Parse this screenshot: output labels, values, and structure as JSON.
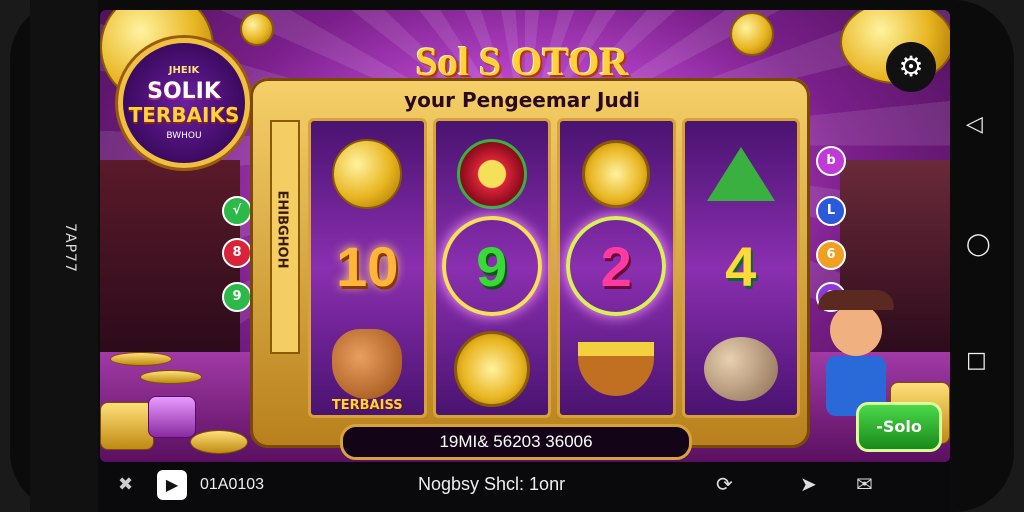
{
  "device": {
    "side_label": "7AP77",
    "system_nav": [
      "back-icon",
      "home-icon",
      "recent-icon"
    ]
  },
  "logo": {
    "line_small": "JHEIK",
    "line_main": "SOLIK",
    "line_banner": "TERBAIKS",
    "line_bottom": "BWHOU"
  },
  "header": {
    "title": "Sol S OTOR",
    "subtitle": "your Pengeemar Judi"
  },
  "side_panel_label": "EHIBGHOH",
  "reels": [
    {
      "symbols": [
        "gold-coin-stack",
        "10",
        "bear-mascot"
      ],
      "mascot_label": "TERBAISS"
    },
    {
      "symbols": [
        "red-coin",
        "9",
        "sun-coin"
      ]
    },
    {
      "symbols": [
        "star-coin",
        "2",
        "idol-bowl"
      ]
    },
    {
      "symbols": [
        "green-hat",
        "4",
        "treasure-sack"
      ]
    }
  ],
  "counter_text": "19MI& 56203 36006",
  "spin_button_label": "-Solo",
  "left_chips": [
    {
      "label": "√",
      "color": "#2db84a"
    },
    {
      "label": "8",
      "color": "#d8243a"
    },
    {
      "label": "9",
      "color": "#2db84a"
    }
  ],
  "right_chips": [
    {
      "label": "b",
      "color": "#c03ad8"
    },
    {
      "label": "L",
      "color": "#2a5ad8"
    },
    {
      "label": "6",
      "color": "#f0a020"
    },
    {
      "label": "9",
      "color": "#8a3ad8"
    }
  ],
  "bottom_bar": {
    "close_glyph": "✖",
    "app_glyph": "▶",
    "balance_text": "01A0103",
    "center_text": "Nogbsy Shcl: 1onr",
    "icons": [
      "refresh-icon",
      "send-icon",
      "chat-icon"
    ]
  },
  "colors": {
    "gold": "#f0c040",
    "purple": "#7a1f8a",
    "spin_green": "#2db84a"
  }
}
